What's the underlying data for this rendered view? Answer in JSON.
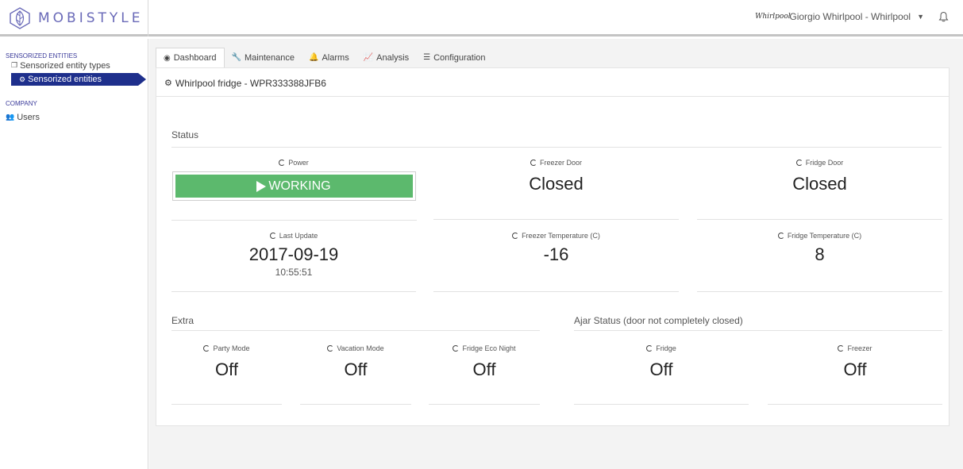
{
  "brand": {
    "name": "MOBISTYLE"
  },
  "user": {
    "avatar_text": "Whirlpool",
    "name": "Giorgio Whirlpool - Whirlpool"
  },
  "sidebar": {
    "sections": [
      {
        "title": "SENSORIZED ENTITIES"
      },
      {
        "title": "COMPANY"
      }
    ],
    "items": [
      {
        "label": "Sensorized entity types",
        "icon": "copy-icon"
      },
      {
        "label": "Sensorized entities",
        "icon": "cogs-icon",
        "active": true
      },
      {
        "label": "Users",
        "icon": "users-icon"
      }
    ]
  },
  "tabs": [
    {
      "label": "Dashboard",
      "icon": "tachometer-icon",
      "active": true
    },
    {
      "label": "Maintenance",
      "icon": "wrench-icon"
    },
    {
      "label": "Alarms",
      "icon": "bell-icon"
    },
    {
      "label": "Analysis",
      "icon": "area-chart-icon"
    },
    {
      "label": "Configuration",
      "icon": "sliders-icon"
    }
  ],
  "panel": {
    "title": "Whirlpool fridge - WPR333388JFB6"
  },
  "status": {
    "title": "Status",
    "power": {
      "label": "Power",
      "value": "WORKING",
      "color": "#5cb96d"
    },
    "freezer_door": {
      "label": "Freezer Door",
      "value": "Closed"
    },
    "fridge_door": {
      "label": "Fridge Door",
      "value": "Closed"
    },
    "last_update": {
      "label": "Last Update",
      "date": "2017-09-19",
      "time": "10:55:51"
    },
    "freezer_temp": {
      "label": "Freezer Temperature (C)",
      "value": "-16"
    },
    "fridge_temp": {
      "label": "Fridge Temperature (C)",
      "value": "8"
    }
  },
  "extra": {
    "title": "Extra",
    "party_mode": {
      "label": "Party Mode",
      "value": "Off"
    },
    "vacation_mode": {
      "label": "Vacation Mode",
      "value": "Off"
    },
    "fridge_eco_night": {
      "label": "Fridge Eco Night",
      "value": "Off"
    }
  },
  "ajar": {
    "title": "Ajar Status (door not completely closed)",
    "fridge": {
      "label": "Fridge",
      "value": "Off"
    },
    "freezer": {
      "label": "Freezer",
      "value": "Off"
    }
  },
  "colors": {
    "accent": "#1e2f8c",
    "brand": "#6a6ab8",
    "working": "#5cb96d"
  }
}
